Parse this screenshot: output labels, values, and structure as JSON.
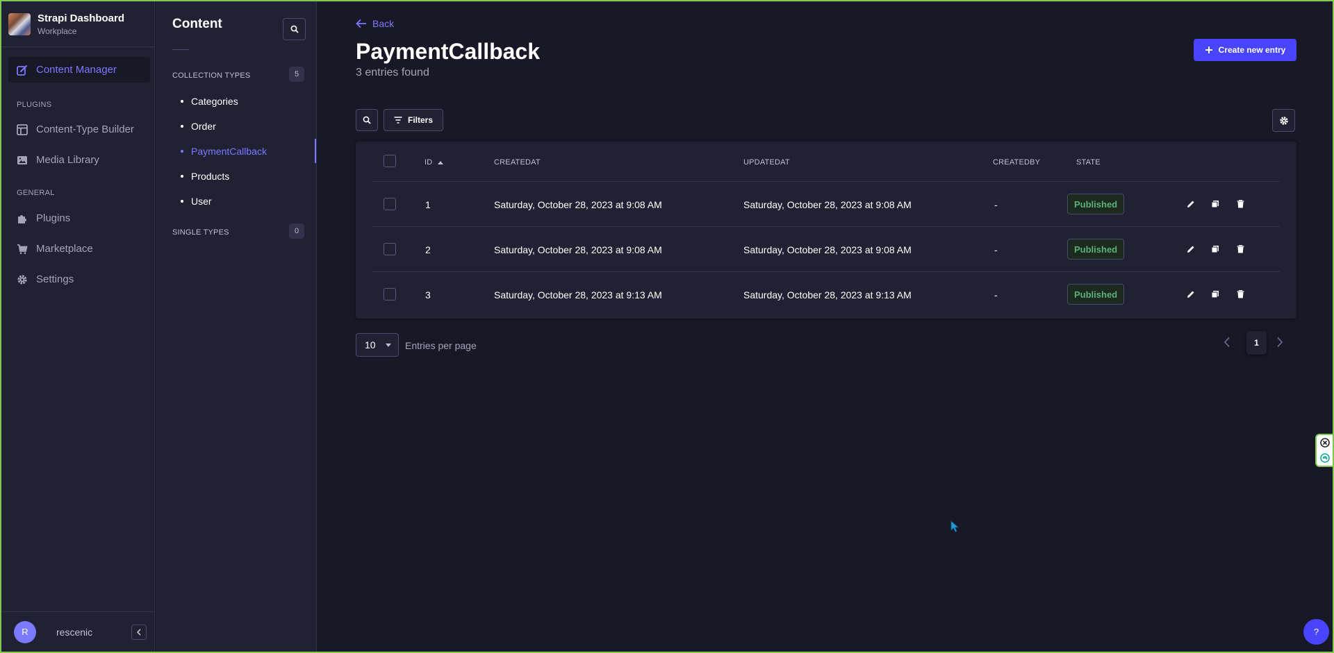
{
  "brand": {
    "title": "Strapi Dashboard",
    "subtitle": "Workplace"
  },
  "mainnav": {
    "active_label": "Content Manager",
    "plugins_section": "PLUGINS",
    "general_section": "GENERAL",
    "items": [
      {
        "label": "Content-Type Builder",
        "icon": "layout-icon"
      },
      {
        "label": "Media Library",
        "icon": "image-icon"
      },
      {
        "label": "Plugins",
        "icon": "puzzle-icon"
      },
      {
        "label": "Marketplace",
        "icon": "cart-icon"
      },
      {
        "label": "Settings",
        "icon": "gear-icon"
      }
    ],
    "user": {
      "initial": "R",
      "name": "rescenic"
    }
  },
  "subnav": {
    "title": "Content",
    "collection_section": "COLLECTION TYPES",
    "collection_count": "5",
    "collection_items": [
      "Categories",
      "Order",
      "PaymentCallback",
      "Products",
      "User"
    ],
    "single_section": "SINGLE TYPES",
    "single_count": "0"
  },
  "main": {
    "back_label": "Back",
    "title": "PaymentCallback",
    "subtitle": "3 entries found",
    "create_label": "Create new entry",
    "filters_label": "Filters",
    "columns": [
      "ID",
      "CREATEDAT",
      "UPDATEDAT",
      "CREATEDBY",
      "STATE"
    ],
    "rows": [
      {
        "id": "1",
        "createdAt": "Saturday, October 28, 2023 at 9:08 AM",
        "updatedAt": "Saturday, October 28, 2023 at 9:08 AM",
        "createdBy": "-",
        "state": "Published"
      },
      {
        "id": "2",
        "createdAt": "Saturday, October 28, 2023 at 9:08 AM",
        "updatedAt": "Saturday, October 28, 2023 at 9:08 AM",
        "createdBy": "-",
        "state": "Published"
      },
      {
        "id": "3",
        "createdAt": "Saturday, October 28, 2023 at 9:13 AM",
        "updatedAt": "Saturday, October 28, 2023 at 9:13 AM",
        "createdBy": "-",
        "state": "Published"
      }
    ],
    "per_page_value": "10",
    "per_page_label": "Entries per page",
    "current_page": "1"
  },
  "help_label": "?",
  "colors": {
    "accent": "#4945ff",
    "accent_text": "#7b79ff",
    "published": "#5cb176",
    "background": "#181826",
    "panel": "#212134"
  }
}
